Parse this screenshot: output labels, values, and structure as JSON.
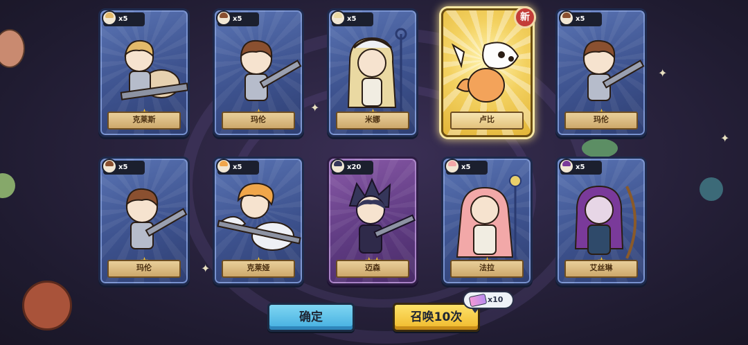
{
  "cards": [
    {
      "name": "克莱斯",
      "count": "x5",
      "stars": "★",
      "style": "blue",
      "hair": "#e3b96a"
    },
    {
      "name": "玛伦",
      "count": "x5",
      "stars": "★",
      "style": "blue",
      "hair": "#8a5030"
    },
    {
      "name": "米娜",
      "count": "x5",
      "stars": "★",
      "style": "blue",
      "hair": "#ead9a2"
    },
    {
      "name": "卢比",
      "count": "",
      "stars": "★★★",
      "style": "gold",
      "hair": "#f3a35a"
    },
    {
      "name": "玛伦",
      "count": "x5",
      "stars": "★",
      "style": "blue",
      "hair": "#8a5030"
    },
    {
      "name": "玛伦",
      "count": "x5",
      "stars": "★",
      "style": "blue",
      "hair": "#8a5030"
    },
    {
      "name": "克莱娅",
      "count": "x5",
      "stars": "★",
      "style": "blue",
      "hair": "#f0a64a"
    },
    {
      "name": "迈森",
      "count": "x20",
      "stars": "★★",
      "style": "purple",
      "hair": "#35365a"
    },
    {
      "name": "法拉",
      "count": "x5",
      "stars": "★",
      "style": "blue",
      "hair": "#f2a8a8"
    },
    {
      "name": "艾丝琳",
      "count": "x5",
      "stars": "★",
      "style": "blue",
      "hair": "#7a3a9a"
    }
  ],
  "new_badge": "新",
  "buttons": {
    "confirm": "确定",
    "summon": "召唤10次"
  },
  "cost": {
    "amount": "x10",
    "icon": "summon-ticket-icon"
  }
}
